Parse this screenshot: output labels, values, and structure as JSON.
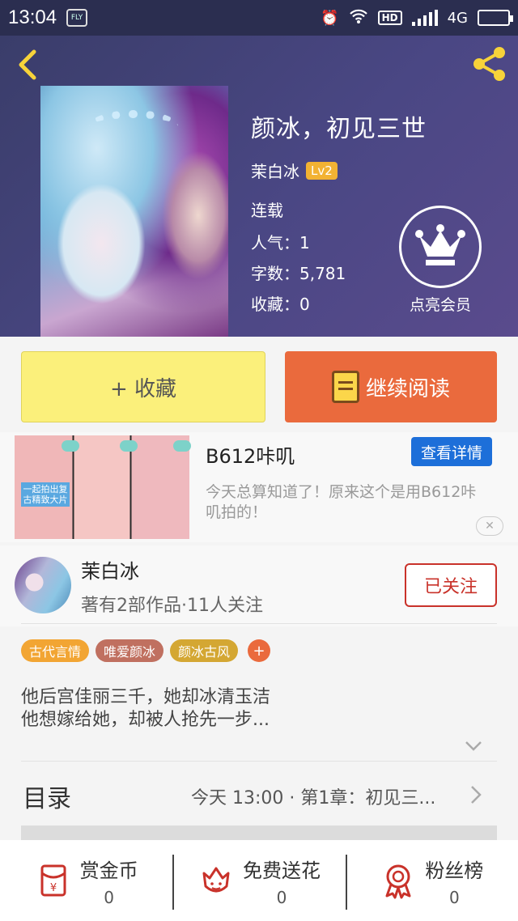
{
  "status_bar": {
    "time": "13:04",
    "app_badge": "FLY",
    "network": "4G",
    "hd": "HD"
  },
  "book": {
    "title": "颜冰，初见三世",
    "author": "茉白冰",
    "level": "Lv2",
    "status": "连载",
    "popularity_label": "人气：",
    "popularity": "1",
    "words_label": "字数：",
    "words": "5,781",
    "favorites_label": "收藏：",
    "favorites": "0"
  },
  "vip": {
    "label": "点亮会员"
  },
  "actions": {
    "favorite": "+ 收藏",
    "continue_read": "继续阅读"
  },
  "ad": {
    "image_text": "一起拍出复古精致大片",
    "title": "B612咔叽",
    "button": "查看详情",
    "description": "今天总算知道了！原来这个是用B612咔叽拍的！",
    "close": "✕"
  },
  "author_card": {
    "name": "茉白冰",
    "subtitle": "著有2部作品·11人关注",
    "follow_button": "已关注"
  },
  "tags": [
    {
      "label": "古代言情",
      "color": "#f2a533"
    },
    {
      "label": "唯爱颜冰",
      "color": "#c07060"
    },
    {
      "label": "颜冰古风",
      "color": "#d4a733"
    }
  ],
  "description": {
    "line1": "他后宫佳丽三千，她却冰清玉洁",
    "line2": "他想嫁给她，却被人抢先一步..."
  },
  "catalog": {
    "label": "目录",
    "latest": "今天 13:00 · 第1章：初见三..."
  },
  "bottom_bar": {
    "reward": {
      "label": "赏金币",
      "count": "0"
    },
    "flowers": {
      "label": "免费送花",
      "count": "0"
    },
    "fans": {
      "label": "粉丝榜",
      "count": "0"
    }
  },
  "colors": {
    "header_bg": "#3a3d6a",
    "accent_yellow": "#f7d33a",
    "favorite_btn": "#fbf07b",
    "read_btn": "#ea6a3d",
    "follow_red": "#c9322a",
    "ad_blue": "#1d6fd9"
  }
}
